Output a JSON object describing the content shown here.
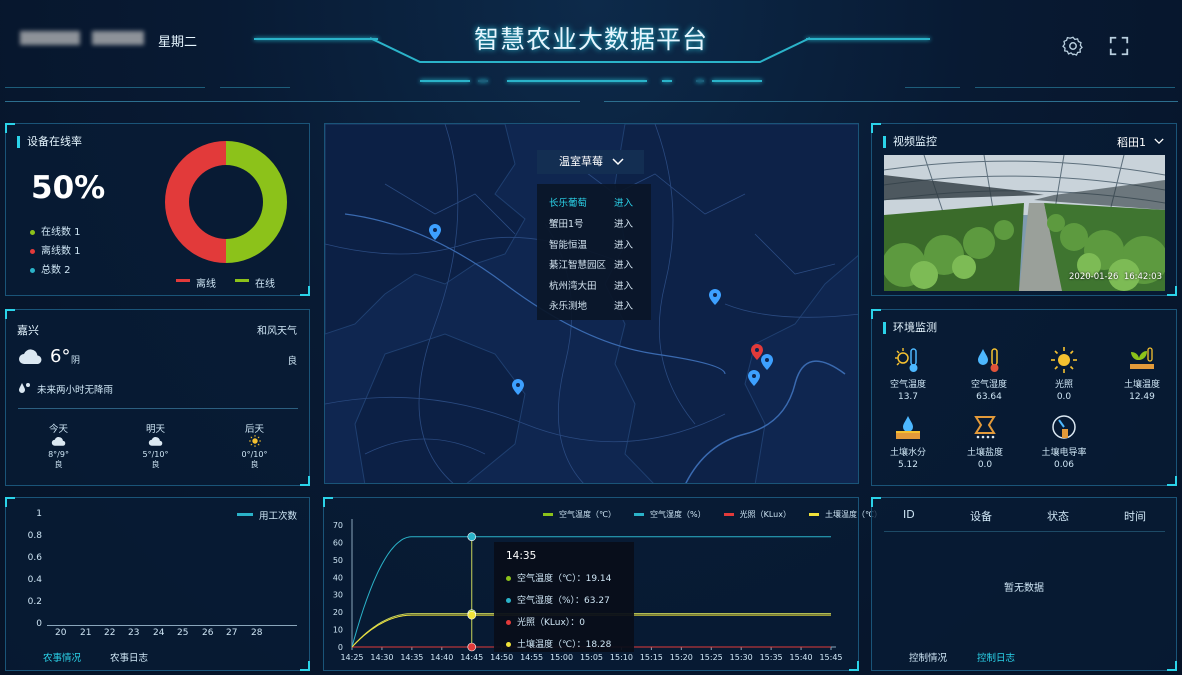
{
  "header": {
    "title": "智慧农业大数据平台",
    "weekday": "星期二"
  },
  "device": {
    "title": "设备在线率",
    "rate": "50%",
    "online_label": "在线数 1",
    "offline_label": "离线数 1",
    "total_label": "总数 2",
    "legend_offline": "离线",
    "legend_online": "在线",
    "online_fraction": 0.5,
    "colors": {
      "online": "#8cc21a",
      "offline": "#e23a3a",
      "total": "#2bb3c9"
    }
  },
  "weather": {
    "city": "嘉兴",
    "source": "和风天气",
    "temp": "6°",
    "condition": "阴",
    "quality": "良",
    "rain_note": "未来两小时无降雨",
    "days": [
      {
        "name": "今天",
        "range": "8°/9°",
        "quality": "良",
        "icon": "cloud-icon"
      },
      {
        "name": "明天",
        "range": "5°/10°",
        "quality": "良",
        "icon": "cloud-icon"
      },
      {
        "name": "后天",
        "range": "0°/10°",
        "quality": "良",
        "icon": "sun-icon"
      }
    ]
  },
  "farm_chart": {
    "legend": "用工次数",
    "yticks": [
      "1",
      "0.8",
      "0.6",
      "0.4",
      "0.2",
      "0"
    ],
    "xticks": [
      "20",
      "21",
      "22",
      "23",
      "24",
      "25",
      "26",
      "27",
      "28"
    ],
    "tab_active": "农事情况",
    "tab_inactive": "农事日志"
  },
  "map": {
    "dropdown": "温室草莓",
    "items": [
      {
        "name": "长乐葡萄",
        "action": "进入",
        "active": true
      },
      {
        "name": "蟹田1号",
        "action": "进入"
      },
      {
        "name": "智能恒温",
        "action": "进入"
      },
      {
        "name": "綦江智慧园区",
        "action": "进入"
      },
      {
        "name": "杭州湾大田",
        "action": "进入"
      },
      {
        "name": "永乐测地",
        "action": "进入"
      }
    ]
  },
  "video": {
    "title": "视频监控",
    "selector": "稻田1",
    "timestamp": "2020-01-26  16:42:03"
  },
  "environment": {
    "title": "环境监测",
    "items": [
      {
        "label": "空气温度",
        "value": "13.7",
        "icon": "thermometer-sun-icon"
      },
      {
        "label": "空气湿度",
        "value": "63.64",
        "icon": "humidity-icon"
      },
      {
        "label": "光照",
        "value": "0.0",
        "icon": "sun-icon"
      },
      {
        "label": "土壤温度",
        "value": "12.49",
        "icon": "soil-temp-icon"
      },
      {
        "label": "土壤水分",
        "value": "5.12",
        "icon": "soil-water-icon"
      },
      {
        "label": "土壤盐度",
        "value": "0.0",
        "icon": "soil-salt-icon"
      },
      {
        "label": "土壤电导率",
        "value": "0.06",
        "icon": "conductivity-icon"
      }
    ]
  },
  "chart_data": {
    "type": "line",
    "x": [
      "14:25",
      "14:30",
      "14:35",
      "14:40",
      "14:45",
      "14:50",
      "14:55",
      "15:00",
      "15:05",
      "15:10",
      "15:15",
      "15:20",
      "15:25",
      "15:30",
      "15:35",
      "15:40",
      "15:45"
    ],
    "yticks": [
      "70",
      "60",
      "50",
      "40",
      "30",
      "20",
      "10",
      "0"
    ],
    "ylim": [
      0,
      70
    ],
    "series": [
      {
        "name": "空气温度（℃）",
        "color": "#8cc21a",
        "plateau": 19.14,
        "line_color": "#c9d45a"
      },
      {
        "name": "空气湿度（%）",
        "color": "#2bb3c9",
        "plateau": 63.27,
        "line_color": "#2bb3c9"
      },
      {
        "name": "光照（KLux）",
        "color": "#e23a3a",
        "plateau": 0,
        "line_color": "#e23a3a"
      },
      {
        "name": "土壤温度（℃）",
        "color": "#f0e23a",
        "plateau": 18.28,
        "line_color": "#f0e23a"
      }
    ],
    "tooltip": {
      "time": "14:35",
      "rows": [
        {
          "label": "空气温度（℃）：19.14",
          "color": "#8cc21a"
        },
        {
          "label": "空气湿度（%）：63.27",
          "color": "#2bb3c9"
        },
        {
          "label": "光照（KLux）：0",
          "color": "#e23a3a"
        },
        {
          "label": "土壤温度（℃）：18.28",
          "color": "#f0e23a"
        }
      ]
    }
  },
  "logs": {
    "columns": [
      "ID",
      "设备",
      "状态",
      "时间"
    ],
    "empty": "暂无数据",
    "tab_inactive": "控制情况",
    "tab_active": "控制日志"
  }
}
